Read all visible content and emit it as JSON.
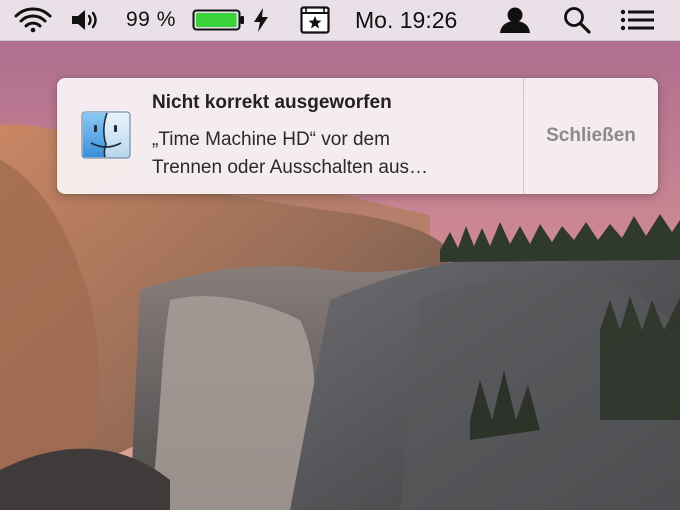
{
  "menubar": {
    "wifi_icon": "wifi-icon",
    "volume_icon": "speaker-volume-icon",
    "battery": {
      "percent_text": "99 %",
      "level": 0.99,
      "charging": true,
      "color": "#3ad23a"
    },
    "clock": "Mo. 19:26",
    "user_icon": "user-silhouette-icon",
    "search_icon": "spotlight-search-icon",
    "notifications_icon": "notification-center-icon",
    "app_icon": "film-clapper-icon"
  },
  "notification": {
    "app_icon": "finder-icon",
    "title": "Nicht korrekt ausgeworfen",
    "body_line1": "„Time Machine HD“ vor dem",
    "body_line2": "Trennen oder Ausschalten aus…",
    "action_label": "Schließen"
  }
}
